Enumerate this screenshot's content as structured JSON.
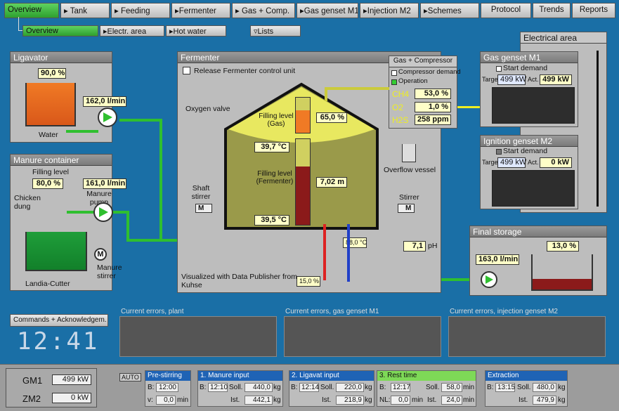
{
  "nav": {
    "overview": "Overview",
    "tank": "Tank",
    "feeding": "Feeding",
    "fermenter": "Fermenter",
    "gas_comp": "Gas + Comp.",
    "gas_genset": "Gas genset M1",
    "injection": "Injection M2",
    "schemes": "Schemes",
    "protocol": "Protocol",
    "trends": "Trends",
    "reports": "Reports"
  },
  "subnav": {
    "overview": "Overview",
    "electr": "Electr. area",
    "hotwater": "Hot water",
    "lists": "Lists"
  },
  "ligavator": {
    "title": "Ligavator",
    "level": "90,0 %",
    "flow": "162,0 l/min",
    "water": "Water"
  },
  "manure": {
    "title": "Manure container",
    "filling_label": "Filling level",
    "filling": "80,0 %",
    "flow": "161,0 l/min",
    "pump": "Manure pump",
    "chicken": "Chicken dung",
    "stirrer": "Manure stirrer",
    "cutter": "Landia-Cutter"
  },
  "fermenter": {
    "title": "Fermenter",
    "release": "Release Fermenter control unit",
    "oxygen": "Oxygen valve",
    "level_gas_label": "Filling level (Gas)",
    "level_gas": "65,0 %",
    "temp_top": "39,7 °C",
    "level_ferm_label": "Filling level (Fermenter)",
    "level_ferm": "7,02 m",
    "temp_bottom": "39,5 °C",
    "shaft": "Shaft stirrer",
    "stirrer": "Stirrer",
    "overflow": "Overflow vessel",
    "ph": "7,1",
    "ph_unit": "pH",
    "heat_temp": "88,0 °C",
    "heat_pct": "15,0 %",
    "credit": "Visualized with Data Publisher from Kuhse",
    "m_label": "M"
  },
  "gascomp": {
    "title": "Gas + Compressor",
    "demand": "Compressor demand",
    "operation": "Operation",
    "ch4_label": "CH4",
    "ch4": "53,0 %",
    "o2_label": "O2",
    "o2": "1,0 %",
    "h2s_label": "H2S",
    "h2s": "258 ppm"
  },
  "electrical": {
    "title": "Electrical area"
  },
  "genset1": {
    "title": "Gas genset M1",
    "start": "Start demand",
    "target_label": "Target",
    "target": "499 kW",
    "act_label": "Act.",
    "act": "499 kW"
  },
  "genset2": {
    "title": "Ignition genset M2",
    "start": "Start demand",
    "target_label": "Target",
    "target": "499 kW",
    "act_label": "Act.",
    "act": "0 kW"
  },
  "storage": {
    "title": "Final storage",
    "level": "13,0 %",
    "flow": "163,0 l/min"
  },
  "errors": {
    "plant": "Current errors, plant",
    "genset": "Current errors, gas genset M1",
    "injection": "Current errors, injection genset M2"
  },
  "commands": "Commands + Acknowledgem.",
  "clock": "12:41",
  "bottom": {
    "gm1_label": "GM1",
    "gm1": "499 kW",
    "zm2_label": "ZM2",
    "zm2": "0 kW",
    "auto": "AUTO"
  },
  "sequence": [
    {
      "title": "Pre-stirring",
      "b_label": "B:",
      "b": "12:00",
      "v_label": "v:",
      "v": "0,0",
      "unit": "min"
    },
    {
      "title": "1. Manure input",
      "b_label": "B:",
      "b": "12:10",
      "soll_label": "Soll.",
      "soll": "440,0",
      "ist_label": "Ist.",
      "ist": "442,1",
      "unit": "kg"
    },
    {
      "title": "2. Ligavat input",
      "b_label": "B:",
      "b": "12:14",
      "soll_label": "Soll.",
      "soll": "220,0",
      "ist_label": "Ist.",
      "ist": "218,9",
      "unit": "kg"
    },
    {
      "title": "3. Rest time",
      "b_label": "B:",
      "b": "12:17",
      "soll_label": "Soll.",
      "soll": "58,0",
      "ist_label": "Ist.",
      "ist": "24,0",
      "nl_label": "NL:",
      "nl": "0,0",
      "unit": "min"
    },
    {
      "title": "Extraction",
      "b_label": "B:",
      "b": "13:15",
      "soll_label": "Soll.",
      "soll": "480,0",
      "ist_label": "Ist.",
      "ist": "479,9",
      "unit": "kg"
    }
  ],
  "colors": {
    "bg": "#1a6fa6",
    "pipe": "#2fbf2f",
    "active_step": "#7ed957",
    "step": "#1f63b5"
  }
}
